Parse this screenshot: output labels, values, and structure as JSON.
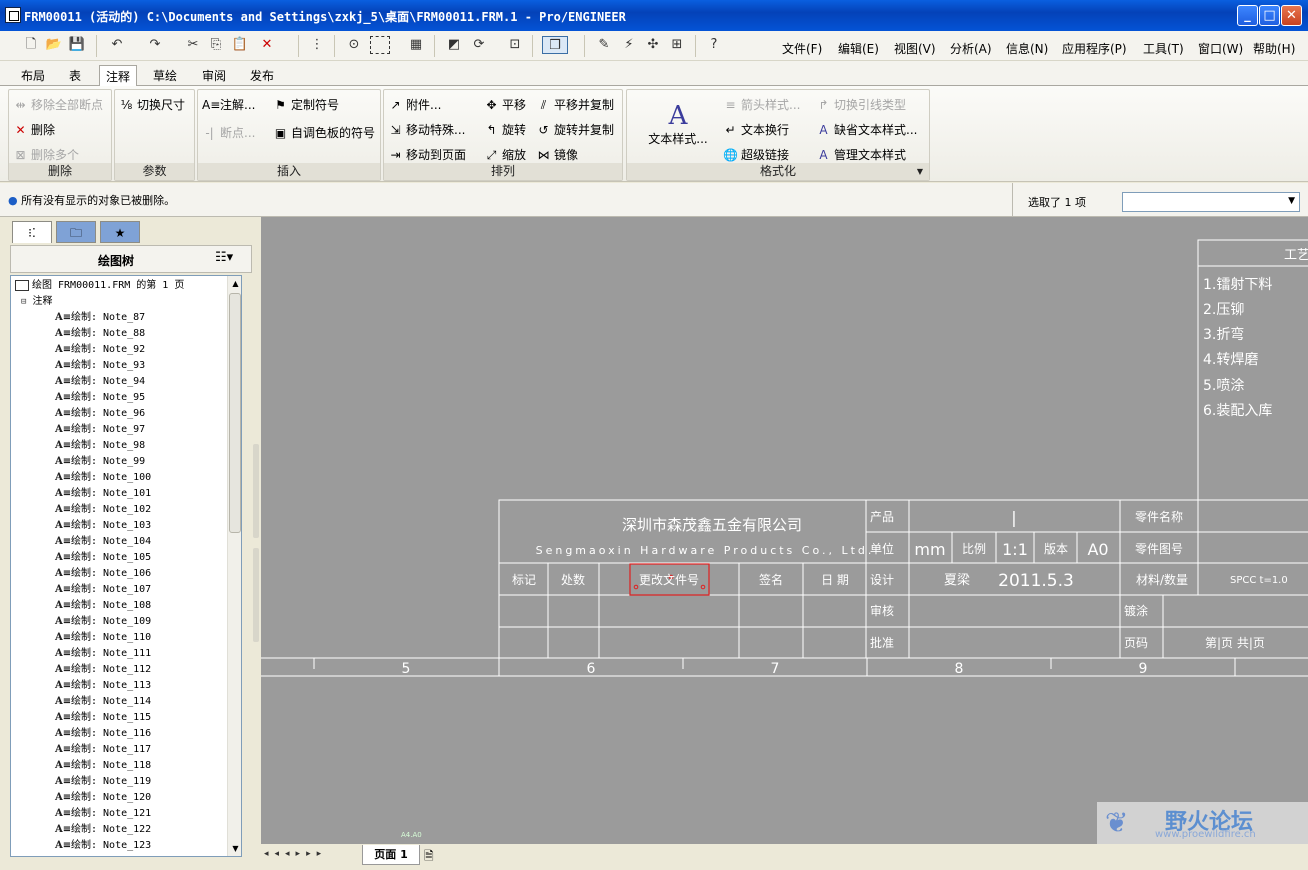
{
  "window": {
    "title": "FRM00011 (活动的) C:\\Documents and Settings\\zxkj_5\\桌面\\FRM00011.FRM.1 - Pro/ENGINEER"
  },
  "toolbar": {
    "icons": [
      "new-icon",
      "open-icon",
      "save-icon",
      "undo-icon",
      "redo-icon",
      "cut-icon",
      "copy-icon",
      "paste-icon",
      "delete-icon",
      "tree-icon",
      "find-icon",
      "select-box-icon",
      "properties-icon",
      "repaint-icon",
      "refresh-icon",
      "zoom-icon",
      "display-style-icon",
      "note-icon",
      "symbol-icon",
      "snap-icon",
      "grid-icon",
      "context-help-icon"
    ],
    "menus": [
      "文件(F)",
      "编辑(E)",
      "视图(V)",
      "分析(A)",
      "信息(N)",
      "应用程序(P)",
      "工具(T)",
      "窗口(W)",
      "帮助(H)"
    ]
  },
  "tabs": [
    "布局",
    "表",
    "注释",
    "草绘",
    "审阅",
    "发布"
  ],
  "active_tab": "注释",
  "ribbon": {
    "groups": {
      "delete": {
        "title": "删除",
        "remove_all_breaks": "移除全部断点",
        "delete": "删除",
        "delete_multiple": "删除多个"
      },
      "params": {
        "title": "参数",
        "toggle_dim": "切换尺寸"
      },
      "insert": {
        "title": "插入",
        "note": "注解...",
        "breakpoint": "断点...",
        "custom_symbol": "定制符号",
        "palette_symbol": "自调色板的符号"
      },
      "arrange": {
        "title": "排列",
        "attach": "附件...",
        "move_special": "移动特殊...",
        "move_to_page": "移动到页面",
        "translate": "平移",
        "rotate": "旋转",
        "scale": "缩放",
        "translate_copy": "平移并复制",
        "rotate_copy": "旋转并复制",
        "mirror": "镜像"
      },
      "format": {
        "title": "格式化",
        "text_style": "文本样式...",
        "arrow_style": "箭头样式...",
        "text_wrap": "文本换行",
        "hyperlink": "超级链接",
        "toggle_leader": "切换引线类型",
        "default_text_style": "缺省文本样式...",
        "manage_text_style": "管理文本样式"
      }
    }
  },
  "message": {
    "text": "所有没有显示的对象已被删除。",
    "selection_label": "选取了 1 项",
    "filter_value": ""
  },
  "left_panel": {
    "title": "绘图树",
    "root": "绘图 FRM00011.FRM 的第 1 页",
    "folder": "注释",
    "notes": [
      "绘制: Note_87",
      "绘制: Note_88",
      "绘制: Note_92",
      "绘制: Note_93",
      "绘制: Note_94",
      "绘制: Note_95",
      "绘制: Note_96",
      "绘制: Note_97",
      "绘制: Note_98",
      "绘制: Note_99",
      "绘制: Note_100",
      "绘制: Note_101",
      "绘制: Note_102",
      "绘制: Note_103",
      "绘制: Note_104",
      "绘制: Note_105",
      "绘制: Note_106",
      "绘制: Note_107",
      "绘制: Note_108",
      "绘制: Note_109",
      "绘制: Note_110",
      "绘制: Note_111",
      "绘制: Note_112",
      "绘制: Note_113",
      "绘制: Note_114",
      "绘制: Note_115",
      "绘制: Note_116",
      "绘制: Note_117",
      "绘制: Note_118",
      "绘制: Note_119",
      "绘制: Note_120",
      "绘制: Note_121",
      "绘制: Note_122",
      "绘制: Note_123"
    ]
  },
  "drawing": {
    "company_cn": "深圳市森茂鑫五金有限公司",
    "company_en": "Sengmaoxin Hardware Products Co., Ltd.",
    "headers": [
      "标记",
      "处数",
      "更改文件号",
      "签名",
      "日 期"
    ],
    "product_label": "产品",
    "product_value": "|",
    "part_name_label": "零件名称",
    "unit_label": "单位",
    "unit_value": "mm",
    "scale_label": "比例",
    "scale_value": "1:1",
    "version_label": "版本",
    "version_value": "A0",
    "part_no_label": "零件图号",
    "design_label": "设计",
    "designer": "夏梁",
    "design_date": "2011.5.3",
    "material_label": "材料/数量",
    "material_value": "SPCC t=1.0",
    "check_label": "审核",
    "plating_label": "镀涂",
    "approve_label": "批准",
    "page_label": "页码",
    "page_value": "第|页 共|页",
    "zones": [
      "5",
      "6",
      "7",
      "8",
      "9"
    ],
    "process_title": "工艺",
    "process_steps": [
      "1.镭射下料",
      "2.压铆",
      "3.折弯",
      "4.转焊磨",
      "5.喷涂",
      "6.装配入库"
    ],
    "sheet_format": "A4.A0"
  },
  "bottom": {
    "page_tab": "页面 1"
  },
  "watermark": {
    "text": "野火论坛",
    "url": "www.proewildfire.cn"
  }
}
